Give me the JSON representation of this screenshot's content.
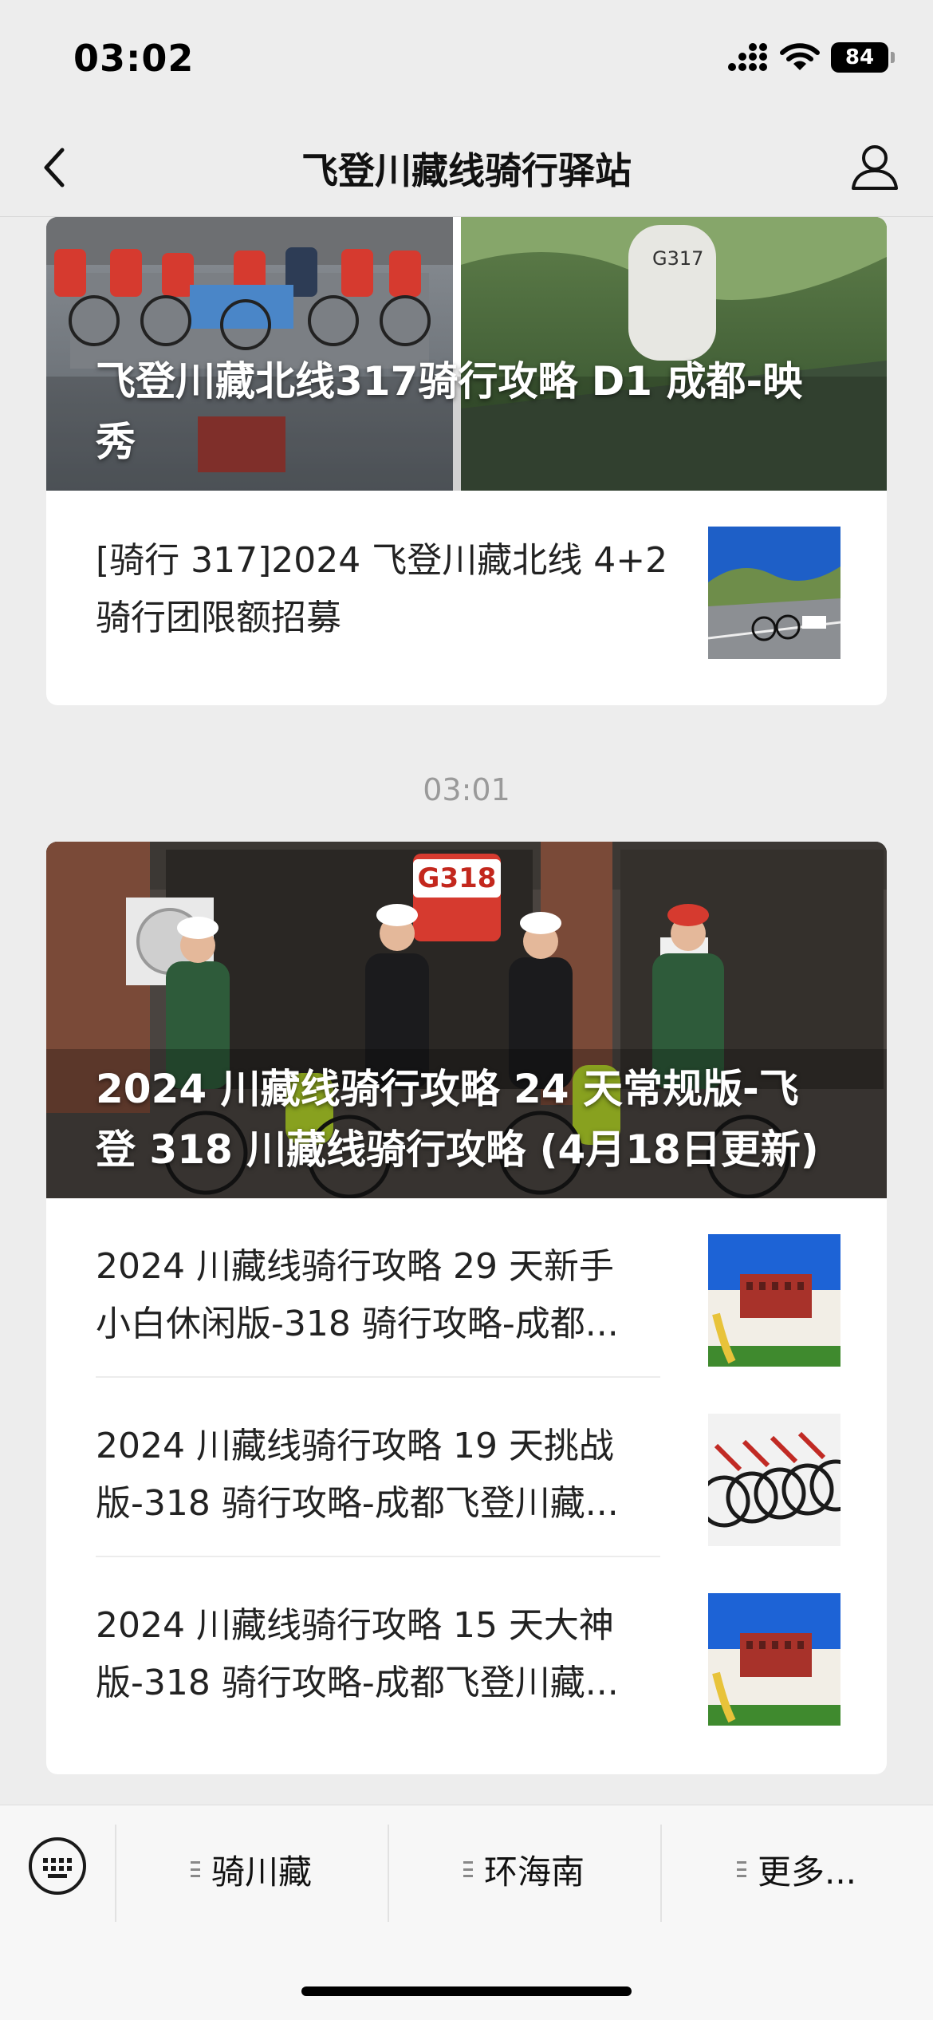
{
  "status_bar": {
    "time": "03:02",
    "battery": "84",
    "icons": [
      "signal-icon",
      "wifi-icon",
      "battery-icon"
    ]
  },
  "nav": {
    "title": "飞登川藏线骑行驿站",
    "back_icon": "chevron-left-icon",
    "profile_icon": "user-icon"
  },
  "message_1": {
    "cover_title": "飞登川藏北线317骑行攻略 D1 成都-映秀",
    "cover_image": "cyclists-group-and-g317-marker-photo",
    "items": [
      {
        "title": "[骑行317]2024飞登川藏北线4+2骑行团限额招募",
        "line1": "[骑行 317]2024 飞登川藏北线 4+2",
        "line2": "骑行团限额招募",
        "thumb": "mountain-road-bicycle-photo"
      }
    ]
  },
  "timestamp": "03:01",
  "message_2": {
    "cover_title": "2024川藏线骑行攻略24天常规版-飞登318川藏线骑行攻略 (4月18日更新)",
    "cover_line1": "2024 川藏线骑行攻略 24 天常规版-飞",
    "cover_line2": "登 318 川藏线骑行攻略 (4月18日更新)",
    "cover_sign": "G318",
    "cover_image": "cyclists-thumbs-up-photo",
    "items": [
      {
        "line1": "2024 川藏线骑行攻略 29 天新手",
        "line2": "小白休闲版-318 骑行攻略-成都...",
        "thumb": "potala-palace-photo"
      },
      {
        "line1": "2024 川藏线骑行攻略 19 天挑战",
        "line2": "版-318 骑行攻略-成都飞登川藏...",
        "thumb": "bicycle-row-photo"
      },
      {
        "line1": "2024 川藏线骑行攻略 15 天大神",
        "line2": "版-318 骑行攻略-成都飞登川藏...",
        "thumb": "potala-palace-photo"
      }
    ]
  },
  "menu": {
    "keyboard_icon": "keyboard-icon",
    "items": [
      {
        "label": "骑川藏"
      },
      {
        "label": "环海南"
      },
      {
        "label": "更多..."
      }
    ]
  },
  "colors": {
    "background": "#ededed",
    "card": "#ffffff",
    "text": "#222222",
    "timestamp": "#9a9a9a"
  }
}
